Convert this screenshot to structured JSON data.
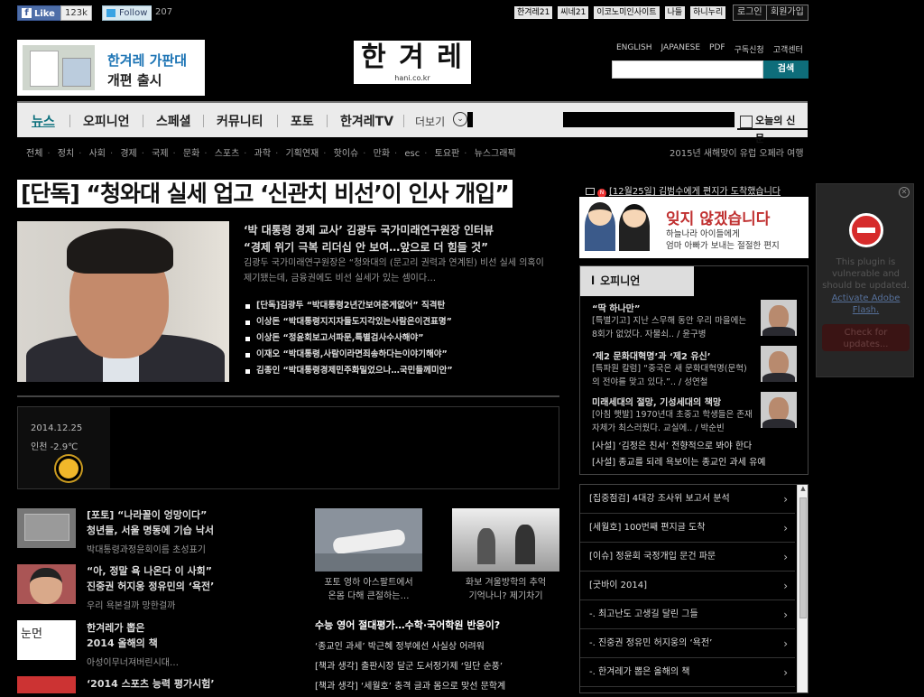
{
  "topbar": {
    "fb_like": "Like",
    "fb_count": "123k",
    "tw_follow": "Follow",
    "tw_count": "207",
    "links": [
      "한겨레21",
      "씨네21",
      "이코노미인사이트",
      "나들",
      "하니누리"
    ],
    "login": "로그인",
    "join": "회원가입"
  },
  "banner": {
    "line1": "한겨레 가판대",
    "line2": "개편 출시"
  },
  "logo": {
    "text": "한 겨 레",
    "url": "hani.co.kr"
  },
  "header_links": [
    "ENGLISH",
    "JAPANESE",
    "PDF",
    "구독신청",
    "고객센터"
  ],
  "search": {
    "placeholder": "",
    "button": "검색"
  },
  "nav": {
    "items": [
      "뉴스",
      "오피니언",
      "스페셜",
      "커뮤니티",
      "포토",
      "한겨레TV"
    ],
    "more": "더보기",
    "today": "오늘의 신문"
  },
  "subnav": [
    "전체",
    "정치",
    "사회",
    "경제",
    "국제",
    "문화",
    "스포츠",
    "과학",
    "기획연재",
    "핫이슈",
    "만화",
    "esc",
    "토요판",
    "뉴스그래픽"
  ],
  "subnav_right": "2015년 새해맞이 유럽 오페라 여행",
  "headline": "[단독] “청와대 실세 업고 ‘신관치 비선’이 인사 개입”",
  "main": {
    "sub1": "‘박 대통령 경제 교사’ 김광두 국가미래연구원장 인터뷰",
    "sub2": "“경제 위기 극복 리더십 안 보여…앞으로 더 힘들 것”",
    "summary": "김광두 국가미래연구원장은 “청와대의 (문고리 권력과 연계된) 비선 실세 의혹이 제기됐는데, 금융권에도 비선 실세가 있는 셈이다…",
    "related": [
      "[단독]김광두 “박대통령2년간보여준게없어” 직격탄",
      "이상돈 “박대통령지지자들도지각있는사람은이견표명”",
      "이상돈 “정윤회보고서파문,특별검사수사해야”",
      "이재오 “박대통령,사람이라면죄송하다는이야기해야”",
      "김종인 “박대통령경제민주화밀었으나…국민들께미안”"
    ]
  },
  "weather": {
    "date": "2014.12.25",
    "temp": "인천 -2.9℃",
    "icon": "sun-icon"
  },
  "left_list": [
    {
      "title": "[포토] “나라꼴이 엉망이다”",
      "title2": "청년들, 서울 명동에 기습 낙서",
      "sub": "박대통령과정윤회이름 초성표기"
    },
    {
      "title": "“아, 정말 욕 나온다 이 사회”",
      "title2": "진중권 허지웅 정유민의 ‘욕전’",
      "sub": "우리 욕본걸까 망한걸까"
    },
    {
      "title": "한겨레가 뽑은",
      "title2": "2014 올해의 책",
      "sub": "아성이무너져버린시대…"
    },
    {
      "title": "‘2014 스포츠 능력 평가시험’",
      "title2": "",
      "sub": ""
    }
  ],
  "photos": [
    {
      "caption1": "포토 영하 아스팔트에서",
      "caption2": "온몸 다해 큰절하는…"
    },
    {
      "caption1": "화보 겨울방학의 추억",
      "caption2": "기억나니? 제기차기"
    }
  ],
  "mid_list": {
    "head": "수능 영어 절대평가…수학·국어학원 반응이?",
    "rows": [
      "‘종교인 과세’ 박근혜 정부에선 사실상 어려워",
      "[책과 생각] 출판시장 달군 도서정가제 ‘일단 순풍’",
      "[책과 생각] ‘세월호’ 충격 글과 몸으로 맞선 문학계"
    ]
  },
  "right": {
    "mail": "[12월25일] 김범수에게 편지가 도착했습니다",
    "mail_badge": "N",
    "ad_title": "잊지 않겠습니다",
    "ad_line1": "하늘나라 아이들에게",
    "ad_line2": "엄마 아빠가 보내는 절절한 편지",
    "opinion_tab": "오피니언",
    "opinion": [
      {
        "title": "“딱 하나만”",
        "sub": "[특별기고] 지난 스무해 동안 우리 마을에는 8회가 없었다. 자물쇠.. / 윤구병"
      },
      {
        "title": "‘제2 문화대혁명’과 ‘제2 유신’",
        "sub": "[특파원 칼럼] “중국은 새 문화대혁명(문혁)의 전야를 맞고 있다.”.. / 성연철"
      },
      {
        "title": "미래세대의 절망, 기성세대의 책망",
        "sub": "[아침 햇발] 1970년대 초중고 학생들은 존재 자체가 최스러웠다. 교실에.. / 박순빈"
      }
    ],
    "opinion_bottom": [
      "[사설] ‘김정은 친서’ 전향적으로 봐야 한다",
      "[사설] 종교를 되레 욕보이는 종교인 과세 유예"
    ],
    "issues": [
      "[집중점검] 4대강 조사위 보고서 분석",
      "[세월호] 100번째 편지글 도착",
      "[이슈] 정윤회 국정개입 문건 파문",
      "[굿바이 2014]",
      "-. 최고난도 고생길 달린 그들",
      "-. 진중권 정유민 허지웅의 ‘욕전’",
      "-. 한겨레가 뽑은 올해의 책"
    ]
  },
  "plugin": {
    "message": "This plugin is vulnerable and should be updated.",
    "link": "Activate Adobe Flash.",
    "button": "Check for updates..."
  }
}
